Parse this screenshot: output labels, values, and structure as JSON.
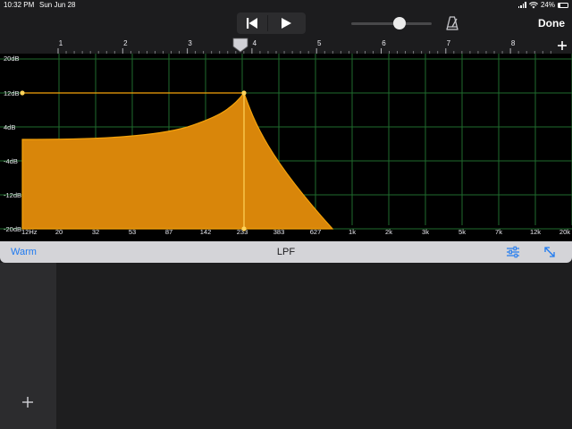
{
  "status_bar": {
    "time": "10:32 PM",
    "date": "Sun Jun 28",
    "battery_percent": "24%",
    "battery_level": 0.24
  },
  "toolbar": {
    "rewind_icon": "skip-to-start-icon",
    "play_icon": "play-icon",
    "volume_level": 0.6,
    "metronome_icon": "metronome-icon",
    "done_label": "Done"
  },
  "ruler": {
    "bars": [
      "1",
      "2",
      "3",
      "4",
      "5",
      "6",
      "7",
      "8"
    ],
    "add_icon": "plus-icon"
  },
  "eq": {
    "accent_color": "#f5a30a",
    "fill_color": "#d9860a",
    "grid_color": "#1f6b2e",
    "db_labels": [
      "20dB",
      "12dB",
      "4dB",
      "-4dB",
      "-12dB",
      "-20dB"
    ],
    "freq_labels": [
      "12Hz",
      "20",
      "32",
      "53",
      "87",
      "142",
      "233",
      "383",
      "627",
      "1k",
      "2k",
      "3k",
      "5k",
      "7k",
      "12k",
      "20k"
    ],
    "cutoff_freq": "233",
    "resonance_db": 12
  },
  "plugin_bar": {
    "preset": "Warm",
    "filter": "LPF",
    "settings_icon": "sliders-icon",
    "resize_icon": "resize-icon"
  },
  "tracks": {
    "add_icon": "plus-icon"
  }
}
